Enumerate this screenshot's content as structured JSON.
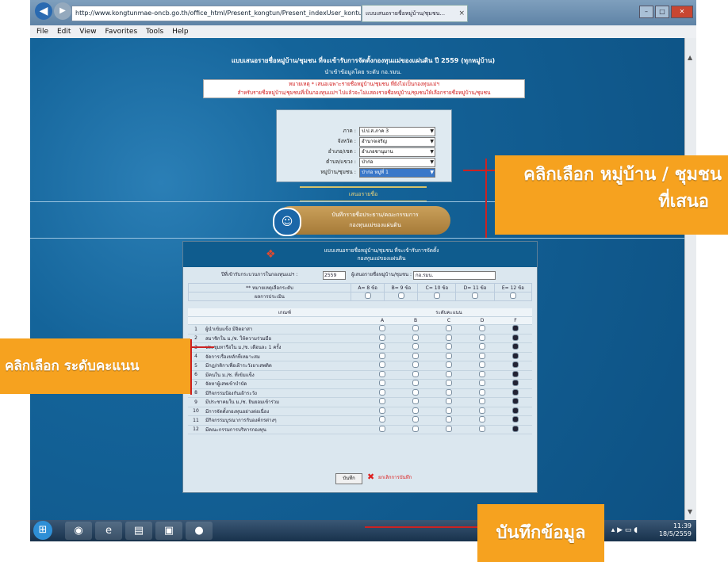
{
  "browser": {
    "url": "http://www.kongtunmae-oncb.go.th/office_html/Present_kongtun/Present_indexUser_kontun ...",
    "tab_title": "แบบเสนอรายชื่อหมู่บ้าน/ชุมชน...",
    "tab_close": "×",
    "back_icon": "◀",
    "forward_icon": "▶",
    "window_controls": [
      "–",
      "□",
      "✕"
    ],
    "right_icons": "⌂ ★ ⚙"
  },
  "menu": [
    "File",
    "Edit",
    "View",
    "Favorites",
    "Tools",
    "Help"
  ],
  "page": {
    "heading": "แบบเสนอรายชื่อหมู่บ้าน/ชุมชน ที่จะเข้ารับการจัดตั้งกองทุนแม่ของแผ่นดิน ปี 2559 (ทุกหมู่บ้าน)",
    "subheading": "นำเข้าข้อมูลโดย ระดับ กอ.รมน.",
    "note_line1": "หมายเหตุ * เสนอเฉพาะรายชื่อหมู่บ้าน/ชุมชน ที่ยังไม่เป็นกองทุนแม่ฯ",
    "note_line2": "สำหรับรายชื่อหมู่บ้าน/ชุมชนที่เป็นกองทุนแม่ฯ ไปแล้วจะไม่แสดงรายชื่อหมู่บ้าน/ชุมชนให้เลือกรายชื่อหมู่บ้าน/ชุมชน",
    "form": [
      {
        "label": "ภาค :",
        "value": "ป.ป.ส.ภาค 3",
        "selected": false
      },
      {
        "label": "จังหวัด :",
        "value": "อำนาจเจริญ",
        "selected": false
      },
      {
        "label": "อำเภอ/เขต :",
        "value": "อำเภอชานุมาน",
        "selected": false
      },
      {
        "label": "ตำบล/แขวง :",
        "value": "ป่าก่อ",
        "selected": false
      },
      {
        "label": "หมู่บ้าน/ชุมชน :",
        "value": "ป่าก่อ หมู่ที่ 1",
        "selected": true
      }
    ],
    "dropdown_arrow": "▼",
    "submit_label": "เสนอรายชื่อ",
    "banner_icon": "☺",
    "banner_line1": "บันทึกรายชื่อประธาน/คณะกรรมการ",
    "banner_line2": "กองทุนแม่ของแผ่นดิน"
  },
  "panel": {
    "icon": "❖",
    "title_line1": "แบบเสนอรายชื่อหมู่บ้าน/ชุมชน ที่จะเข้ารับการจัดตั้ง",
    "title_line2": "กองทุนแม่ของแผ่นดิน",
    "year_label": "ปีที่เข้ารับกระบวนการในกองทุนแม่ฯ :",
    "year_value": "2559",
    "org_label": "ผู้เสนอรายชื่อหมู่บ้าน/ชุมชน :",
    "org_value": "กอ.รมน.",
    "level_header": "** หมายเหตุเลือกระดับ",
    "levels": [
      "A= 8 ข้อ",
      "B= 9 ข้อ",
      "C= 10 ข้อ",
      "D= 11 ข้อ",
      "E= 12 ข้อ"
    ],
    "assessment_label": "ผลการประเมิน",
    "table_header_item": "เกณฑ์",
    "table_header_level": "ระดับคะแนน",
    "columns": [
      "A",
      "B",
      "C",
      "D",
      "F"
    ],
    "criteria": [
      {
        "no": "1",
        "text": "ผู้นำเข้มแข็ง มีจิตอาสา",
        "selected": 4
      },
      {
        "no": "2",
        "text": "สมาชิกใน ม./ช. ให้ความร่วมมือ",
        "selected": 4
      },
      {
        "no": "3",
        "text": "ประชุมหารือใน ม./ช. เดือนละ 1 ครั้ง",
        "selected": 4
      },
      {
        "no": "4",
        "text": "จัดการเรื่องหลักที่เหมาะสม",
        "selected": 4
      },
      {
        "no": "5",
        "text": "มีกฎ/กติกาเพื่อเฝ้าระวังยาเสพติด",
        "selected": 4
      },
      {
        "no": "6",
        "text": "มีคนใน ม./ช. ที่เข้มแข็ง",
        "selected": 4
      },
      {
        "no": "7",
        "text": "จัดหาผู้เสพเข้าบำบัด",
        "selected": 4
      },
      {
        "no": "8",
        "text": "มีกิจกรรมป้องกันเฝ้าระวัง",
        "selected": 4
      },
      {
        "no": "9",
        "text": "มีประชาคมใน ม./ช. ยินยอมเข้าร่วม",
        "selected": 4
      },
      {
        "no": "10",
        "text": "มีการจัดตั้งกองทุนอย่างต่อเนื่อง",
        "selected": 4
      },
      {
        "no": "11",
        "text": "มีกิจกรรมบูรณาการกับองค์กรต่างๆ",
        "selected": 4
      },
      {
        "no": "12",
        "text": "มีคณะกรรมการบริหารกองทุน",
        "selected": 4
      }
    ],
    "save_label": "บันทึก",
    "delete_icon": "✖",
    "delete_label": "ยกเลิกการบันทึก"
  },
  "taskbar": {
    "start_icon": "⊞",
    "apps": [
      "◉",
      "e",
      "▤",
      "▣",
      "●"
    ],
    "tray_icons": "▴ ▶ ▭ ◖",
    "time": "11:39",
    "date": "18/5/2559"
  },
  "callouts": {
    "village_line1": "คลิกเลือก หมู่บ้าน / ชุมชน",
    "village_line2": "ที่เสนอ",
    "score": "คลิกเลือก ระดับคะแนน",
    "save": "บันทึกข้อมูล"
  }
}
